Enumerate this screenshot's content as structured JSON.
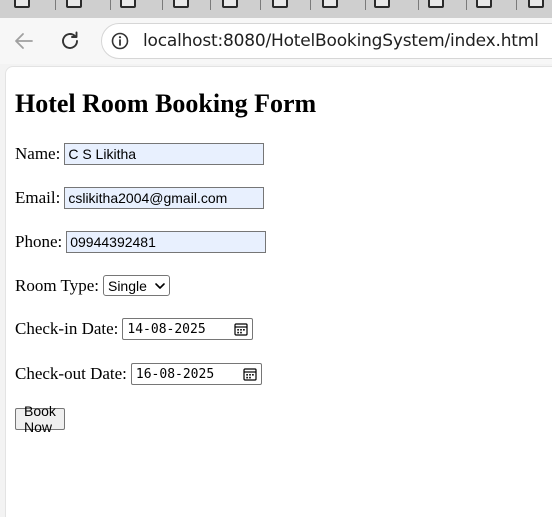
{
  "browser": {
    "url": "localhost:8080/HotelBookingSystem/index.html",
    "back_icon": "arrow-left-icon",
    "reload_icon": "reload-icon",
    "site_info_icon": "info-icon"
  },
  "form": {
    "title": "Hotel Room Booking Form",
    "name": {
      "label": "Name:",
      "value": "C S Likitha"
    },
    "email": {
      "label": "Email:",
      "value": "cslikitha2004@gmail.com"
    },
    "phone": {
      "label": "Phone:",
      "value": "09944392481"
    },
    "room_type": {
      "label": "Room Type:",
      "selected": "Single"
    },
    "checkin": {
      "label": "Check-in Date:",
      "value": "14-08-2025"
    },
    "checkout": {
      "label": "Check-out Date:",
      "value": "16-08-2025"
    },
    "submit_label": "Book Now"
  },
  "colors": {
    "autofill_bg": "#e8f0fe",
    "chrome_bg": "#f7f7f7",
    "tabstrip_bg": "#cfcfcf"
  }
}
